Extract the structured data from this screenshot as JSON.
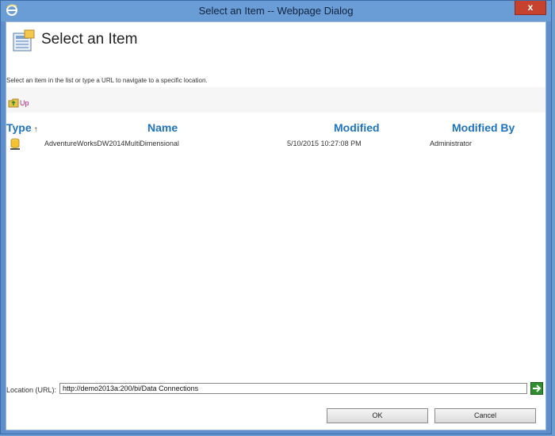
{
  "window": {
    "title": "Select an Item -- Webpage Dialog",
    "close_glyph": "x"
  },
  "header": {
    "title": "Select an Item",
    "icon": "list-picker-icon"
  },
  "instruction": "Select an item in the list or type a URL to navigate to a specific location.",
  "toolbar": {
    "up_label": "Up",
    "up_icon": "folder-up-icon"
  },
  "columns": {
    "type": "Type",
    "type_sort": "↑",
    "name": "Name",
    "modified": "Modified",
    "modified_by": "Modified By"
  },
  "rows": [
    {
      "icon": "database-icon",
      "name": "AdventureWorksDW2014MultiDimensional",
      "modified": "5/10/2015 10:27:08 PM",
      "modified_by": "Administrator"
    }
  ],
  "location": {
    "label": "Location (URL):",
    "value": "http://demo2013a:200/bi/Data Connections"
  },
  "buttons": {
    "ok": "OK",
    "cancel": "Cancel"
  },
  "colors": {
    "header_link": "#1e73be",
    "up_link": "#c01c7a",
    "close_red": "#c7412f",
    "title_bar": "#6a9dd6"
  }
}
